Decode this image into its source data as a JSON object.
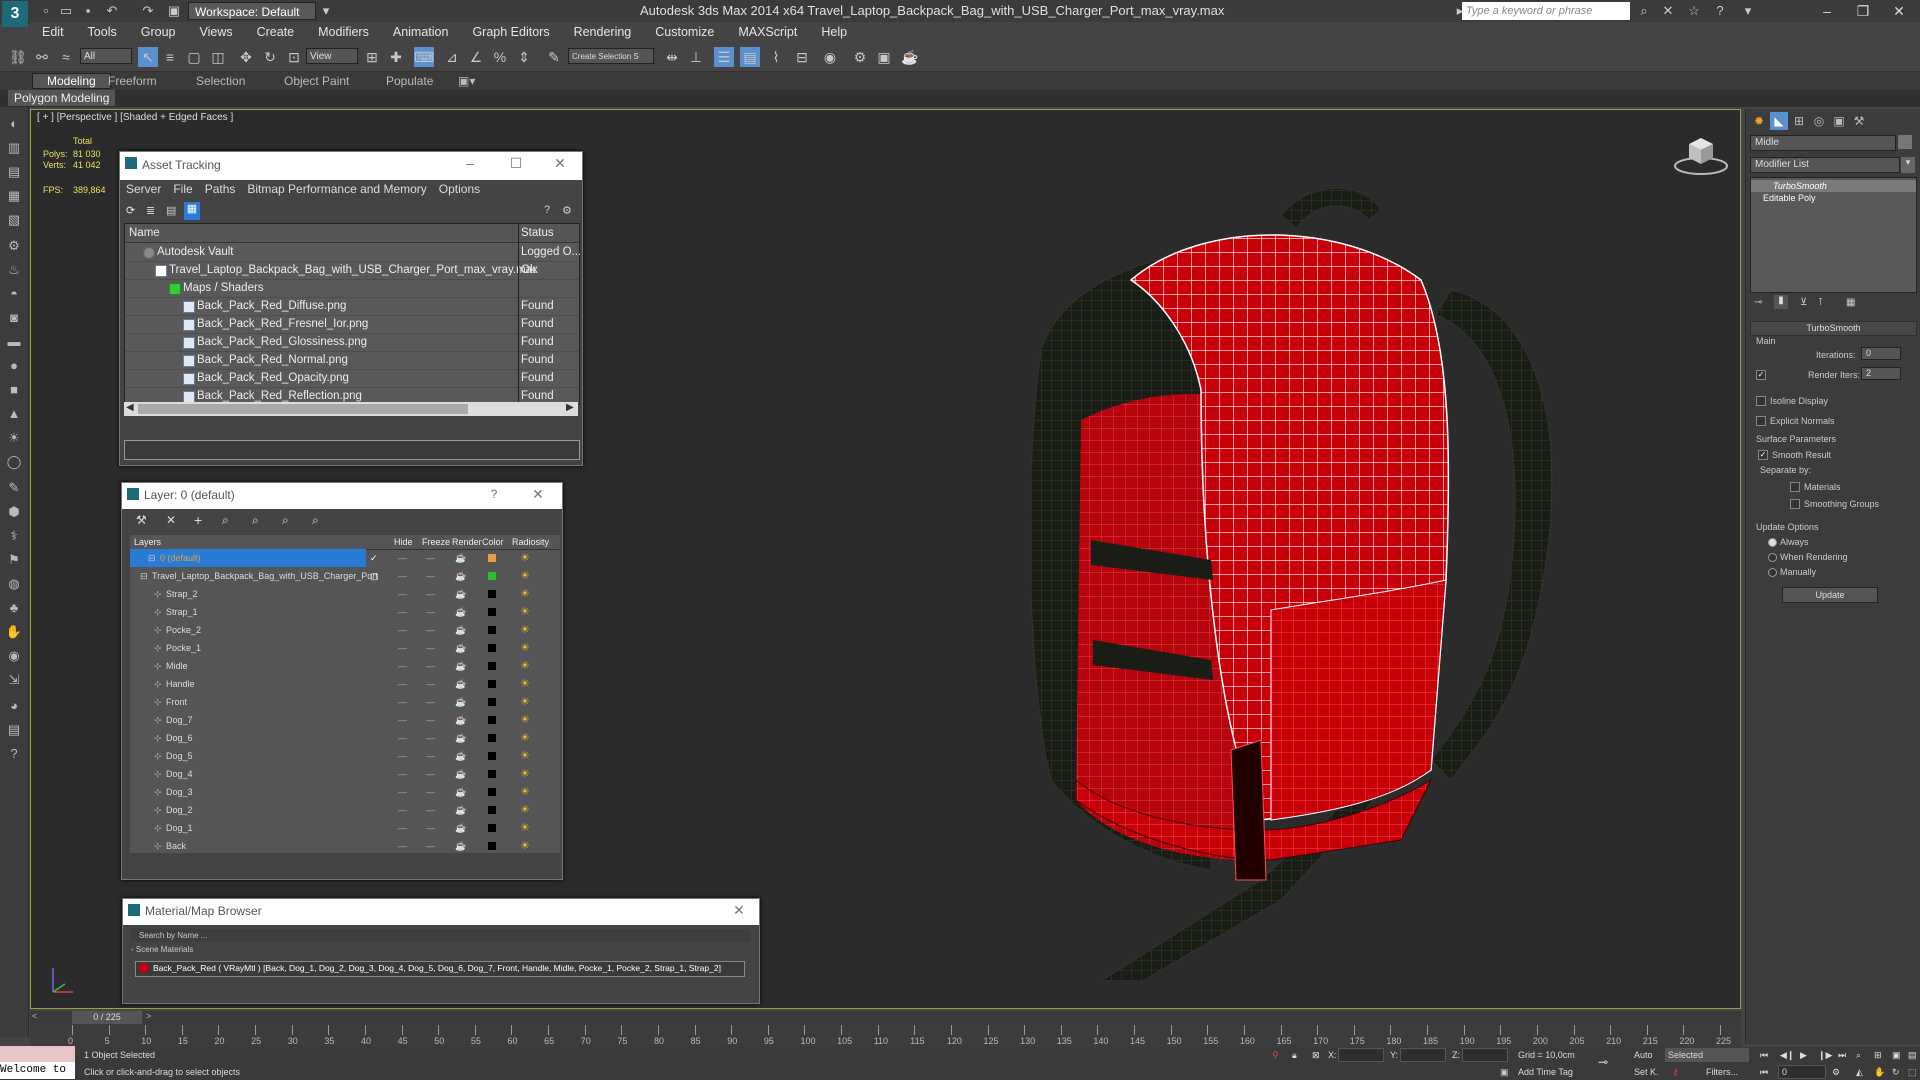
{
  "titlebar": {
    "title": "Autodesk 3ds Max  2014 x64     Travel_Laptop_Backpack_Bag_with_USB_Charger_Port_max_vray.max",
    "workspace": "Workspace: Default",
    "search_placeholder": "Type a keyword or phrase",
    "logo": "3"
  },
  "menubar": [
    "Edit",
    "Tools",
    "Group",
    "Views",
    "Create",
    "Modifiers",
    "Animation",
    "Graph Editors",
    "Rendering",
    "Customize",
    "MAXScript",
    "Help"
  ],
  "toolbar": {
    "filter_all": "All",
    "view_select": "View",
    "named_selection": "Create Selection S"
  },
  "ribbon": {
    "tabs": [
      "Modeling",
      "Freeform",
      "Selection",
      "Object Paint",
      "Populate"
    ],
    "active": "Modeling",
    "panel": "Polygon Modeling"
  },
  "viewport": {
    "label": "[ + ] [Perspective ] [Shaded + Edged Faces ]",
    "stats": {
      "total_label": "Total",
      "polys_label": "Polys:",
      "polys_value": "81 030",
      "verts_label": "Verts:",
      "verts_value": "41 042",
      "fps_label": "FPS:",
      "fps_value": "389,864"
    }
  },
  "asset_tracking": {
    "title": "Asset Tracking",
    "menu": [
      "Server",
      "File",
      "Paths",
      "Bitmap Performance and Memory",
      "Options"
    ],
    "columns": {
      "name": "Name",
      "status": "Status"
    },
    "rows": [
      {
        "name": "Autodesk Vault",
        "status": "Logged O..."
      },
      {
        "name": "Travel_Laptop_Backpack_Bag_with_USB_Charger_Port_max_vray.max",
        "status": "Ok"
      },
      {
        "name": "Maps / Shaders",
        "status": ""
      },
      {
        "name": "Back_Pack_Red_Diffuse.png",
        "status": "Found"
      },
      {
        "name": "Back_Pack_Red_Fresnel_Ior.png",
        "status": "Found"
      },
      {
        "name": "Back_Pack_Red_Glossiness.png",
        "status": "Found"
      },
      {
        "name": "Back_Pack_Red_Normal.png",
        "status": "Found"
      },
      {
        "name": "Back_Pack_Red_Opacity.png",
        "status": "Found"
      },
      {
        "name": "Back_Pack_Red_Reflection.png",
        "status": "Found"
      }
    ]
  },
  "layers": {
    "title": "Layer: 0 (default)",
    "help": "?",
    "columns": [
      "Layers",
      "Hide",
      "Freeze",
      "Render",
      "Color",
      "Radiosity"
    ],
    "rows": [
      {
        "name": "0 (default)",
        "color": "#e0a040",
        "selected": true
      },
      {
        "name": "Travel_Laptop_Backpack_Bag_with_USB_Charger_Port",
        "color": "#30c030"
      },
      {
        "name": "Strap_2",
        "color": "#000000"
      },
      {
        "name": "Strap_1",
        "color": "#000000"
      },
      {
        "name": "Pocke_2",
        "color": "#000000"
      },
      {
        "name": "Pocke_1",
        "color": "#000000"
      },
      {
        "name": "Midle",
        "color": "#000000"
      },
      {
        "name": "Handle",
        "color": "#000000"
      },
      {
        "name": "Front",
        "color": "#000000"
      },
      {
        "name": "Dog_7",
        "color": "#000000"
      },
      {
        "name": "Dog_6",
        "color": "#000000"
      },
      {
        "name": "Dog_5",
        "color": "#000000"
      },
      {
        "name": "Dog_4",
        "color": "#000000"
      },
      {
        "name": "Dog_3",
        "color": "#000000"
      },
      {
        "name": "Dog_2",
        "color": "#000000"
      },
      {
        "name": "Dog_1",
        "color": "#000000"
      },
      {
        "name": "Back",
        "color": "#000000"
      }
    ]
  },
  "material_browser": {
    "title": "Material/Map Browser",
    "search_placeholder": "Search by Name ...",
    "group": "- Scene Materials",
    "material": "Back_Pack_Red  ( VRayMtl ) [Back, Dog_1, Dog_2, Dog_3, Dog_4, Dog_5, Dog_6, Dog_7, Front, Handle, Midle, Pocke_1, Pocke_2, Strap_1, Strap_2]"
  },
  "command_panel": {
    "object_name": "Midle",
    "modifier_list": "Modifier List",
    "stack": [
      "TurboSmooth",
      "Editable Poly"
    ],
    "turbosmooth": {
      "title": "TurboSmooth",
      "main": "Main",
      "iterations_label": "Iterations:",
      "iterations_value": "0",
      "render_iters_label": "Render Iters:",
      "render_iters_value": "2",
      "isoline": "Isoline Display",
      "explicit_normals": "Explicit Normals",
      "surface_params": "Surface Parameters",
      "smooth_result": "Smooth Result",
      "separate_by": "Separate by:",
      "materials": "Materials",
      "smoothing_groups": "Smoothing Groups",
      "update_options": "Update Options",
      "always": "Always",
      "when_rendering": "When Rendering",
      "manually": "Manually",
      "update_button": "Update"
    }
  },
  "timeline": {
    "frame": "0 / 225",
    "ticks": [
      "0",
      "5",
      "10",
      "15",
      "20",
      "25",
      "30",
      "35",
      "40",
      "45",
      "50",
      "55",
      "60",
      "65",
      "70",
      "75",
      "80",
      "85",
      "90",
      "95",
      "100",
      "105",
      "110",
      "115",
      "120",
      "125",
      "130",
      "135",
      "140",
      "145",
      "150",
      "155",
      "160",
      "165",
      "170",
      "175",
      "180",
      "185",
      "190",
      "195",
      "200",
      "205",
      "210",
      "215",
      "220",
      "225"
    ]
  },
  "statusbar": {
    "welcome": "Welcome to",
    "selected": "1 Object Selected",
    "prompt": "Click or click-and-drag to select objects",
    "x_label": "X:",
    "y_label": "Y:",
    "z_label": "Z:",
    "grid": "Grid = 10,0cm",
    "add_time_tag": "Add Time Tag",
    "auto": "Auto",
    "set_key": "Set K.",
    "selected_dropdown": "Selected",
    "filters": "Filters...",
    "frame_field": "0"
  },
  "colors": {
    "viewport_bg": "#2b2b2b",
    "backpack_red": "#c8000a",
    "wire_white": "#ffffff",
    "selection_blue": "#1e6fd6",
    "viewport_border": "#a59a4a"
  }
}
